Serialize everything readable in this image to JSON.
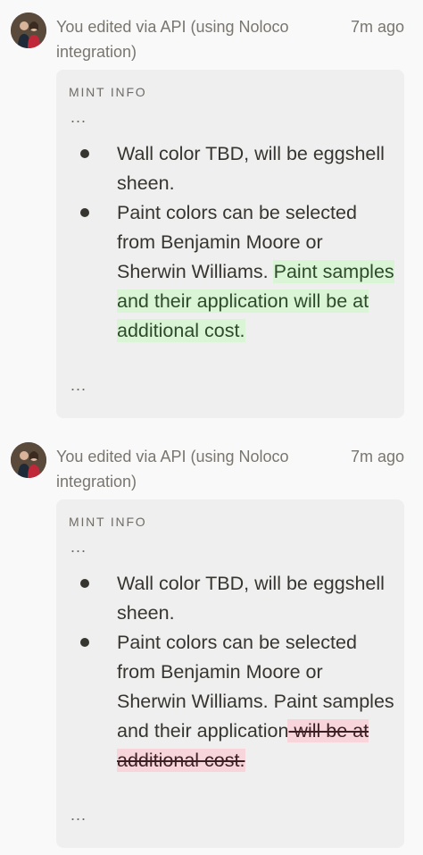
{
  "entries": [
    {
      "meta": "You edited via API (using Noloco integration)",
      "time": "7m ago",
      "card": {
        "label": "MINT INFO",
        "ellipsis_top": "...",
        "ellipsis_bottom": "...",
        "bullet1": "Wall color TBD, will be eggshell sheen.",
        "bullet2_plain": "Paint colors can be selected from Benjamin Moore or Sherwin Williams. ",
        "bullet2_added": "Paint samples and their application will be at additional cost."
      }
    },
    {
      "meta": "You edited via API (using Noloco integration)",
      "time": "7m ago",
      "card": {
        "label": "MINT INFO",
        "ellipsis_top": "...",
        "ellipsis_bottom": "...",
        "bullet1": "Wall color TBD, will be eggshell sheen.",
        "bullet2_plain": "Paint colors can be selected from Benjamin Moore or Sherwin Williams. Paint samples and their application",
        "bullet2_removed": " will be at additional cost."
      }
    }
  ],
  "colors": {
    "added_bg": "#d9f5d6",
    "removed_bg": "#f8d5da"
  }
}
